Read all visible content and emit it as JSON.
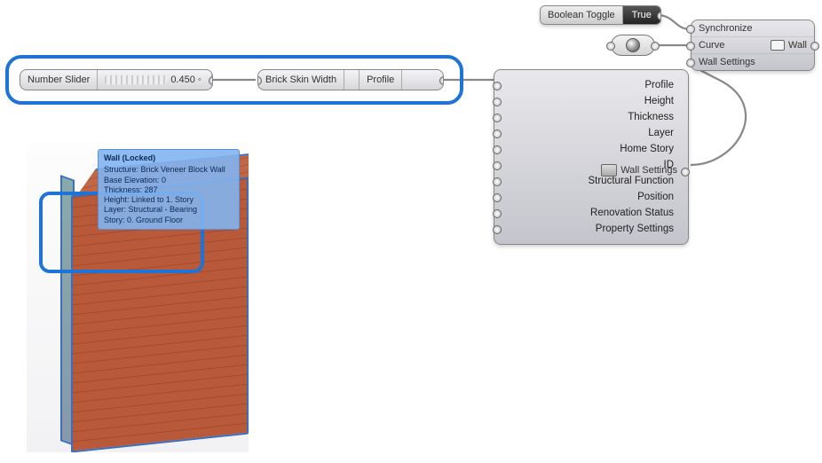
{
  "boolean_toggle": {
    "label": "Boolean Toggle",
    "value": "True"
  },
  "wall_out": {
    "rows": [
      "Synchronize",
      "Curve",
      "Wall Settings"
    ],
    "output_label": "Wall"
  },
  "number_slider": {
    "label": "Number Slider",
    "value": "0.450"
  },
  "brick_skin": {
    "input_label": "Brick Skin Width",
    "output_label": "Profile"
  },
  "wall_settings": {
    "inputs": [
      "Profile",
      "Height",
      "Thickness",
      "Layer",
      "Home Story",
      "ID",
      "Structural Function",
      "Position",
      "Renovation Status",
      "Property Settings"
    ],
    "output_label": "Wall Settings"
  },
  "tooltip": {
    "title": "Wall (Locked)",
    "lines": [
      "Structure: Brick Veneer Block Wall",
      "Base Elevation: 0",
      "Thickness: 287",
      "Height: Linked to 1. Story",
      "Layer: Structural - Bearing",
      "Story: 0. Ground Floor"
    ]
  }
}
